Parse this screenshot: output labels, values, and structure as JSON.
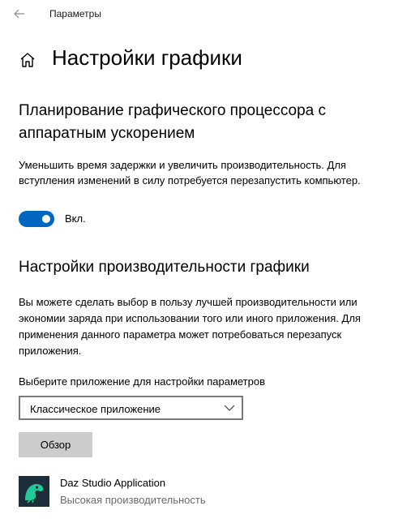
{
  "window": {
    "title": "Параметры"
  },
  "page": {
    "title": "Настройки графики"
  },
  "hags": {
    "title": "Планирование графического процессора с аппаратным ускорением",
    "description": "Уменьшить время задержки и увеличить производительность. Для вступления изменений в силу потребуется перезапустить компьютер.",
    "toggle_state": "on",
    "toggle_label": "Вкл."
  },
  "perf": {
    "title": "Настройки производительности графики",
    "description": "Вы можете сделать выбор в пользу лучшей производительности или экономии заряда при использовании того или иного приложения. Для применения данного параметра может потребоваться перезапуск приложения.",
    "select_label": "Выберите приложение для настройки параметров",
    "select_value": "Классическое приложение",
    "browse_label": "Обзор"
  },
  "apps": [
    {
      "name": "Daz Studio Application",
      "status": "Высокая производительность",
      "icon": "daz-studio-icon"
    }
  ],
  "colors": {
    "accent": "#0067c0",
    "button_bg": "#cccccc",
    "secondary_text": "#6b6b6b",
    "app_icon_bg": "#1c2e3a",
    "app_icon_fg": "#20c997"
  }
}
